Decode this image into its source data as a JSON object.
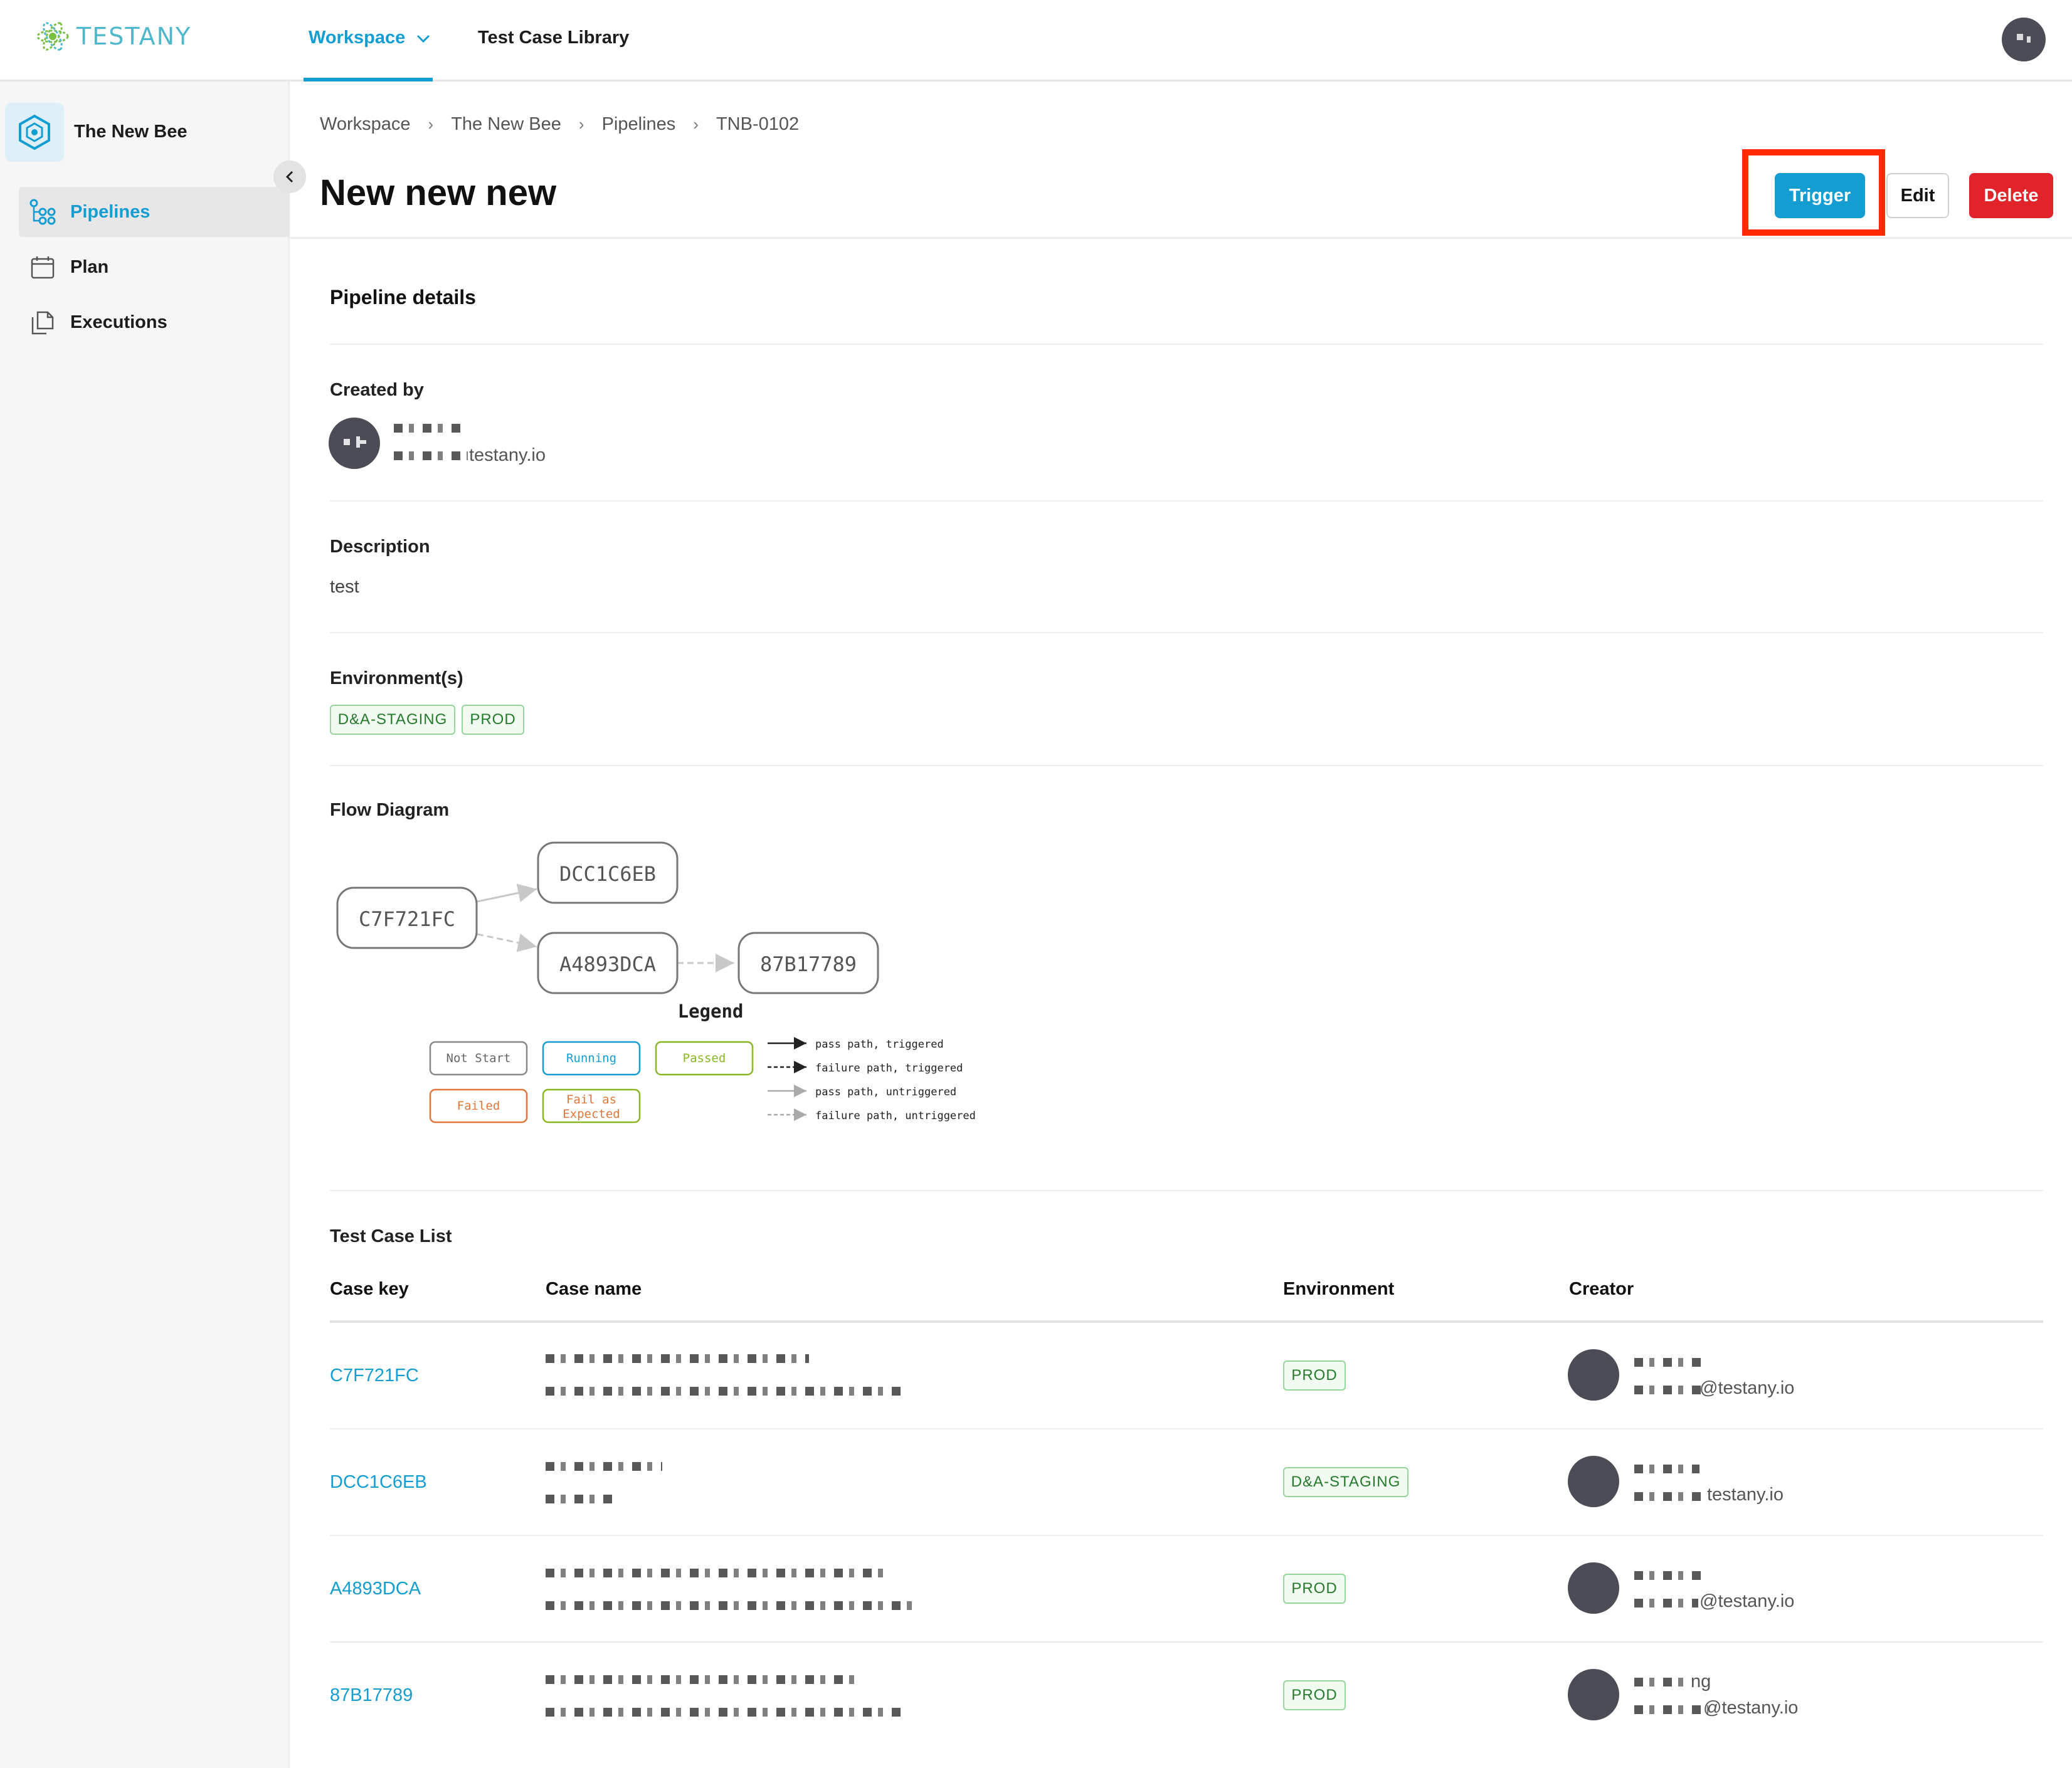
{
  "nav": {
    "logo_text": "TESTANY",
    "workspace_label": "Workspace",
    "library_label": "Test Case Library"
  },
  "sidebar": {
    "project_name": "The New Bee",
    "items": [
      {
        "label": "Pipelines",
        "icon": "pipelines-icon",
        "active": true
      },
      {
        "label": "Plan",
        "icon": "calendar-icon",
        "active": false
      },
      {
        "label": "Executions",
        "icon": "executions-icon",
        "active": false
      }
    ]
  },
  "breadcrumb": [
    "Workspace",
    "The New Bee",
    "Pipelines",
    "TNB-0102"
  ],
  "header": {
    "title": "New new new",
    "trigger_label": "Trigger",
    "edit_label": "Edit",
    "delete_label": "Delete"
  },
  "details": {
    "section_title": "Pipeline details",
    "created_by_label": "Created by",
    "creator_email_suffix": "testany.io",
    "description_label": "Description",
    "description": "test",
    "environments_label": "Environment(s)",
    "environments": [
      "D&A-STAGING",
      "PROD"
    ],
    "flow_label": "Flow Diagram"
  },
  "flow": {
    "nodes": [
      "C7F721FC",
      "DCC1C6EB",
      "A4893DCA",
      "87B17789"
    ],
    "legend_title": "Legend",
    "legend_states": [
      "Not Start",
      "Running",
      "Passed",
      "Failed",
      "Fail as",
      "Expected"
    ],
    "legend_paths": [
      "pass path, triggered",
      "failure path, triggered",
      "pass path, untriggered",
      "failure path, untriggered"
    ]
  },
  "table": {
    "title": "Test Case List",
    "headers": [
      "Case key",
      "Case name",
      "Environment",
      "Creator"
    ],
    "rows": [
      {
        "key": "C7F721FC",
        "env": "PROD",
        "email_suffix": "@testany.io"
      },
      {
        "key": "DCC1C6EB",
        "env": "D&A-STAGING",
        "email_suffix": "testany.io"
      },
      {
        "key": "A4893DCA",
        "env": "PROD",
        "email_suffix": "@testany.io"
      },
      {
        "key": "87B17789",
        "env": "PROD",
        "email_suffix": "@testany.io",
        "name_fragment": "ng"
      }
    ]
  },
  "colors": {
    "accent": "#139dd1",
    "danger": "#e1242a",
    "tag_green": "#257a2c",
    "highlight": "#ff2a00"
  }
}
